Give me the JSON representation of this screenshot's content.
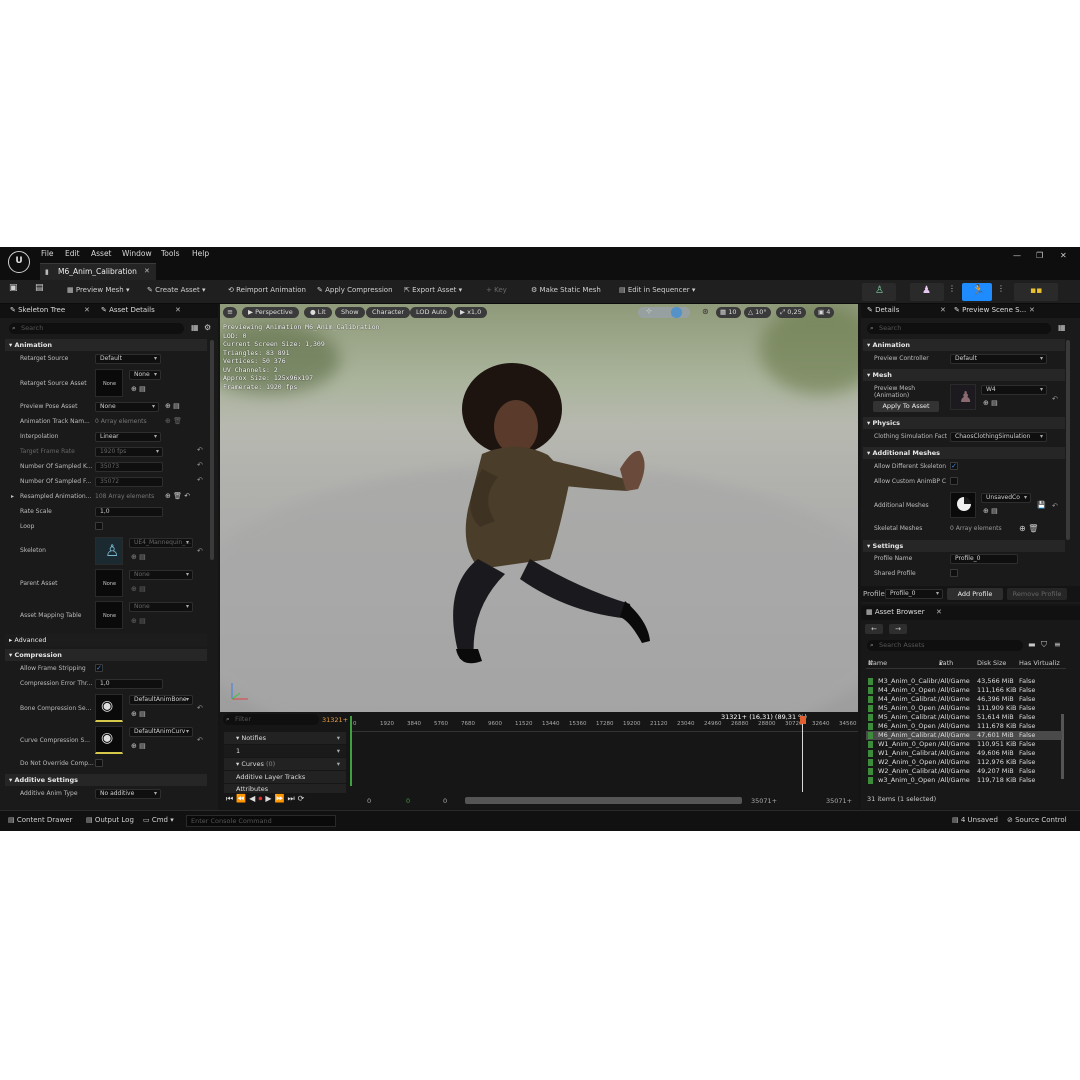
{
  "menu": [
    "File",
    "Edit",
    "Asset",
    "Window",
    "Tools",
    "Help"
  ],
  "document_tab": "M6_Anim_Calibration",
  "toolbar": {
    "preview_mesh": "Preview Mesh",
    "create_asset": "Create Asset",
    "reimport": "Reimport Animation",
    "apply_compression": "Apply Compression",
    "export_asset": "Export Asset",
    "key": "Key",
    "make_static_mesh": "Make Static Mesh",
    "edit_in_sequencer": "Edit in Sequencer"
  },
  "left_panel": {
    "tabs": [
      "Skeleton Tree",
      "Asset Details"
    ],
    "search_placeholder": "Search",
    "sections": {
      "animation": "Animation",
      "advanced": "Advanced",
      "compression": "Compression",
      "additive": "Additive Settings"
    },
    "rows": {
      "retarget_source": {
        "label": "Retarget Source",
        "value": "Default"
      },
      "retarget_source_asset": {
        "label": "Retarget Source Asset",
        "value": "None",
        "thumb": "None"
      },
      "preview_pose_asset": {
        "label": "Preview Pose Asset",
        "value": "None"
      },
      "animation_track_names": {
        "label": "Animation Track Nam...",
        "value": "0 Array elements"
      },
      "interpolation": {
        "label": "Interpolation",
        "value": "Linear"
      },
      "target_frame_rate": {
        "label": "Target Frame Rate",
        "value": "1920 fps"
      },
      "sampled_keys": {
        "label": "Number Of Sampled K...",
        "value": "35073"
      },
      "sampled_frames": {
        "label": "Number Of Sampled F...",
        "value": "35072"
      },
      "resampled_animation": {
        "label": "Resampled Animation...",
        "value": "108 Array elements"
      },
      "rate_scale": {
        "label": "Rate Scale",
        "value": "1,0"
      },
      "loop": {
        "label": "Loop"
      },
      "skeleton": {
        "label": "Skeleton",
        "value": "UE4_Mannequin_..."
      },
      "parent_asset": {
        "label": "Parent Asset",
        "value": "None",
        "thumb": "None"
      },
      "asset_mapping_table": {
        "label": "Asset Mapping Table",
        "value": "None",
        "thumb": "None"
      },
      "allow_frame_stripping": {
        "label": "Allow Frame Stripping"
      },
      "compression_error": {
        "label": "Compression Error Thr...",
        "value": "1,0"
      },
      "bone_compression": {
        "label": "Bone Compression Se...",
        "value": "DefaultAnimBone"
      },
      "curve_compression": {
        "label": "Curve Compression S...",
        "value": "DefaultAnimCurv"
      },
      "do_not_override": {
        "label": "Do Not Override Comp..."
      },
      "additive_anim_type": {
        "label": "Additive Anim Type",
        "value": "No additive"
      }
    }
  },
  "viewport": {
    "perspective": "Perspective",
    "lit": "Lit",
    "show": "Show",
    "character": "Character",
    "lod": "LOD Auto",
    "speed": "x1,0",
    "grid": "10",
    "angle": "10°",
    "scale": "0,25",
    "cams": "4",
    "stats": [
      "Previewing Animation M6_Anim_Calibration",
      "LOD: 0",
      "Current Screen Size: 1,309",
      "Triangles: 83 891",
      "Vertices: 50 376",
      "UV Channels: 2",
      "Approx Size: 125x96x197",
      "Framerate: 1920 fps"
    ]
  },
  "timeline": {
    "filter_placeholder": "Filter",
    "current_frame": "31321+",
    "readout": "31321+ (16,31) (89,31 %)",
    "ticks": [
      "0",
      "1920",
      "3840",
      "5760",
      "7680",
      "9600",
      "11520",
      "13440",
      "15360",
      "17280",
      "19200",
      "21120",
      "23040",
      "24960",
      "26880",
      "28800",
      "30720",
      "32640",
      "34560"
    ],
    "tracks": {
      "notifies": "Notifies",
      "notify_value": "1",
      "curves": "Curves",
      "curves_count": "(0)",
      "additive_layer": "Additive Layer Tracks",
      "attributes": "Attributes"
    },
    "range": [
      "0",
      "0",
      "0",
      "35071+",
      "35071+"
    ]
  },
  "right_panel": {
    "tabs": [
      "Details",
      "Preview Scene S..."
    ],
    "search_placeholder": "Search",
    "sections": {
      "animation": "Animation",
      "mesh": "Mesh",
      "physics": "Physics",
      "additional_meshes": "Additional Meshes",
      "settings": "Settings"
    },
    "rows": {
      "preview_controller": {
        "label": "Preview Controller",
        "value": "Default"
      },
      "preview_mesh": {
        "label": "Preview Mesh\n(Animation)",
        "value": "W4"
      },
      "apply_to_asset": "Apply To Asset",
      "clothing_sim": {
        "label": "Clothing Simulation Fact",
        "value": "ChaosClothingSimulation"
      },
      "allow_diff_skeleton": {
        "label": "Allow Different Skeleton"
      },
      "allow_custom_animbp": {
        "label": "Allow Custom AnimBP C"
      },
      "additional_meshes": {
        "label": "Additional Meshes",
        "value": "UnsavedCo"
      },
      "skeletal_meshes": {
        "label": "Skeletal Meshes",
        "value": "0 Array elements"
      },
      "profile_name": {
        "label": "Profile Name",
        "value": "Profile_0"
      },
      "shared_profile": {
        "label": "Shared Profile"
      }
    },
    "profile_bar": {
      "label": "Profile",
      "value": "Profile_0",
      "add": "Add Profile",
      "remove": "Remove Profile"
    }
  },
  "asset_browser": {
    "title": "Asset Browser",
    "search_placeholder": "Search Assets",
    "columns": [
      "Name",
      "Path",
      "Disk Size",
      "Has Virtualiz"
    ],
    "rows": [
      {
        "name": "M3_Anim_0_Calibrat",
        "path": "/All/Game",
        "size": "43,566 MiB",
        "virt": "False"
      },
      {
        "name": "M4_Anim_0_Open",
        "path": "/All/Game",
        "size": "111,166 KiB",
        "virt": "False"
      },
      {
        "name": "M4_Anim_Calibrat",
        "path": "/All/Game",
        "size": "46,396 MiB",
        "virt": "False"
      },
      {
        "name": "M5_Anim_0_Open",
        "path": "/All/Game",
        "size": "111,909 KiB",
        "virt": "False"
      },
      {
        "name": "M5_Anim_Calibrat",
        "path": "/All/Game",
        "size": "51,614 MiB",
        "virt": "False"
      },
      {
        "name": "M6_Anim_0_Open",
        "path": "/All/Game",
        "size": "111,678 KiB",
        "virt": "False"
      },
      {
        "name": "M6_Anim_Calibrat",
        "path": "/All/Game",
        "size": "47,601 MiB",
        "virt": "False"
      },
      {
        "name": "W1_Anim_0_Open",
        "path": "/All/Game",
        "size": "110,951 KiB",
        "virt": "False"
      },
      {
        "name": "W1_Anim_Calibrat",
        "path": "/All/Game",
        "size": "49,606 MiB",
        "virt": "False"
      },
      {
        "name": "W2_Anim_0_Open",
        "path": "/All/Game",
        "size": "112,976 KiB",
        "virt": "False"
      },
      {
        "name": "W2_Anim_Calibrat",
        "path": "/All/Game",
        "size": "49,207 MiB",
        "virt": "False"
      },
      {
        "name": "w3_Anim_0_Open",
        "path": "/All/Game",
        "size": "119,718 KiB",
        "virt": "False"
      }
    ],
    "selected_index": 6,
    "footer": "31 items (1 selected)"
  },
  "statusbar": {
    "content_drawer": "Content Drawer",
    "output_log": "Output Log",
    "cmd": "Cmd",
    "console_placeholder": "Enter Console Command",
    "unsaved": "4 Unsaved",
    "source_control": "Source Control"
  }
}
